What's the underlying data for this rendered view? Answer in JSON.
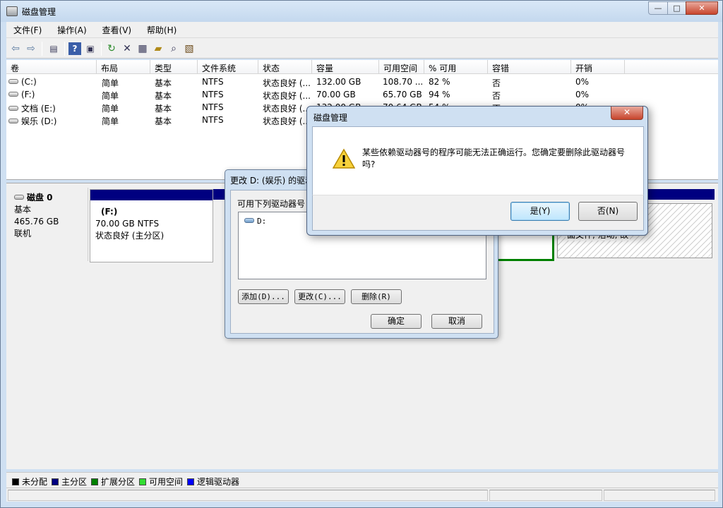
{
  "window": {
    "title": "磁盘管理"
  },
  "menu": [
    "文件(F)",
    "操作(A)",
    "查看(V)",
    "帮助(H)"
  ],
  "toolbar": {
    "icons": [
      "back-arrow-icon",
      "forward-arrow-icon",
      "properties-pane-icon",
      "help-icon",
      "panel-icon",
      "refresh-icon",
      "delete-icon",
      "properties-icon",
      "open-folder-icon",
      "search-icon",
      "wizard-icon"
    ]
  },
  "volume_table": {
    "columns": [
      "卷",
      "布局",
      "类型",
      "文件系统",
      "状态",
      "容量",
      "可用空间",
      "% 可用",
      "容错",
      "开销"
    ],
    "rows": [
      [
        "(C:)",
        "简单",
        "基本",
        "NTFS",
        "状态良好 (...",
        "132.00 GB",
        "108.70 ...",
        "82 %",
        "否",
        "0%"
      ],
      [
        "(F:)",
        "简单",
        "基本",
        "NTFS",
        "状态良好 (...",
        "70.00 GB",
        "65.70 GB",
        "94 %",
        "否",
        "0%"
      ],
      [
        "文档 (E:)",
        "简单",
        "基本",
        "NTFS",
        "状态良好 (...",
        "132.00 GB",
        "70.64 GB",
        "54 %",
        "否",
        "0%"
      ],
      [
        "娱乐 (D:)",
        "简单",
        "基本",
        "NTFS",
        "状态良好 (...",
        "",
        "",
        "",
        "",
        ""
      ]
    ]
  },
  "disk": {
    "name": "磁盘 0",
    "type": "基本",
    "size": "465.76 GB",
    "status": "联机",
    "partition_f": {
      "label": "(F:)",
      "size": "70.00 GB NTFS",
      "status": "状态良好 (主分区)"
    },
    "hatched_text": "面文件, 活动, 故"
  },
  "legend": [
    {
      "label": "未分配",
      "color": "#000000"
    },
    {
      "label": "主分区",
      "color": "#000080"
    },
    {
      "label": "扩展分区",
      "color": "#008000"
    },
    {
      "label": "可用空间",
      "color": "#33dd33"
    },
    {
      "label": "逻辑驱动器",
      "color": "#0000ff"
    }
  ],
  "change_dialog": {
    "title": "更改 D: (娱乐) 的驱动",
    "prompt": "可用下列驱动器号",
    "list_item": "D:",
    "add": "添加(D)...",
    "change": "更改(C)...",
    "remove": "删除(R)",
    "ok": "确定",
    "cancel": "取消"
  },
  "confirm_dialog": {
    "title": "磁盘管理",
    "message": "某些依赖驱动器号的程序可能无法正确运行。您确定要删除此驱动器号吗?",
    "yes": "是(Y)",
    "no": "否(N)"
  }
}
